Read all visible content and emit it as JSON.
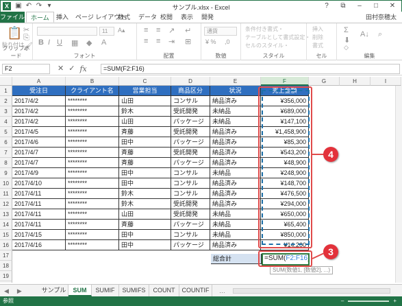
{
  "window": {
    "title": "サンプル.xlsx - Excel",
    "user": "田村奈穂太"
  },
  "ribbon": {
    "tabs": [
      "ファイル",
      "ホーム",
      "挿入",
      "ページ レイアウト",
      "数式",
      "データ",
      "校閲",
      "表示",
      "開発"
    ],
    "active_tab": "ホーム",
    "groups": [
      "クリップボード",
      "フォント",
      "配置",
      "数値",
      "スタイル",
      "セル",
      "編集"
    ],
    "clipboard_paste": "貼り付け",
    "font_size": "11",
    "number_format": "通貨",
    "style_items": [
      "条件付き書式・",
      "テーブルとして書式設定・",
      "セルのスタイル・"
    ],
    "cell_items": [
      "挿入",
      "削除",
      "書式"
    ]
  },
  "formula_bar": {
    "name_box": "F2",
    "formula": "=SUM(F2:F16)"
  },
  "columns": [
    "A",
    "B",
    "C",
    "D",
    "E",
    "F",
    "G",
    "H",
    "I"
  ],
  "rows": [
    "1",
    "2",
    "3",
    "4",
    "5",
    "6",
    "7",
    "8",
    "9",
    "10",
    "11",
    "12",
    "13",
    "14",
    "15",
    "16",
    "17",
    "18",
    "19",
    "20"
  ],
  "table": {
    "headers": [
      "受注日",
      "クライアント名",
      "営業担当",
      "商品区分",
      "状況",
      "売上金額"
    ],
    "rows": [
      [
        "2017/4/2",
        "********",
        "山田",
        "コンサル",
        "納品済み",
        "¥356,000"
      ],
      [
        "2017/4/2",
        "********",
        "鈴木",
        "受託開発",
        "未納品",
        "¥689,000"
      ],
      [
        "2017/4/2",
        "********",
        "山田",
        "パッケージ",
        "未納品",
        "¥147,100"
      ],
      [
        "2017/4/5",
        "********",
        "斉藤",
        "受託開発",
        "納品済み",
        "¥1,458,900"
      ],
      [
        "2017/4/6",
        "********",
        "田中",
        "パッケージ",
        "納品済み",
        "¥85,300"
      ],
      [
        "2017/4/7",
        "********",
        "斉藤",
        "受託開発",
        "納品済み",
        "¥543,200"
      ],
      [
        "2017/4/7",
        "********",
        "斉藤",
        "パッケージ",
        "納品済み",
        "¥48,900"
      ],
      [
        "2017/4/9",
        "********",
        "田中",
        "コンサル",
        "未納品",
        "¥248,900"
      ],
      [
        "2017/4/10",
        "********",
        "田中",
        "コンサル",
        "納品済み",
        "¥148,700"
      ],
      [
        "2017/4/11",
        "********",
        "鈴木",
        "コンサル",
        "納品済み",
        "¥476,500"
      ],
      [
        "2017/4/11",
        "********",
        "鈴木",
        "受託開発",
        "納品済み",
        "¥294,000"
      ],
      [
        "2017/4/11",
        "********",
        "山田",
        "受託開発",
        "未納品",
        "¥650,000"
      ],
      [
        "2017/4/11",
        "********",
        "斉藤",
        "パッケージ",
        "未納品",
        "¥65,400"
      ],
      [
        "2017/4/15",
        "********",
        "田中",
        "コンサル",
        "未納品",
        "¥850,000"
      ],
      [
        "2017/4/16",
        "********",
        "田中",
        "パッケージ",
        "納品済み",
        "¥14,200"
      ]
    ]
  },
  "total": {
    "label": "総合計",
    "formula_prefix": "=SUM(",
    "formula_ref": "F2:F16",
    "formula_suffix": ")",
    "tooltip": "SUM(数値1, [数値2], ...)"
  },
  "callouts": [
    "4",
    "3"
  ],
  "sheets": [
    "サンプル",
    "SUM",
    "SUMIF",
    "SUMIFS",
    "COUNT",
    "COUNTIF"
  ],
  "active_sheet": "SUM",
  "status": "参照",
  "colors": {
    "excel_green": "#217346",
    "header_blue": "#2f6fc0",
    "label_blue": "#d5e2f1",
    "callout_red": "#e3323b"
  }
}
